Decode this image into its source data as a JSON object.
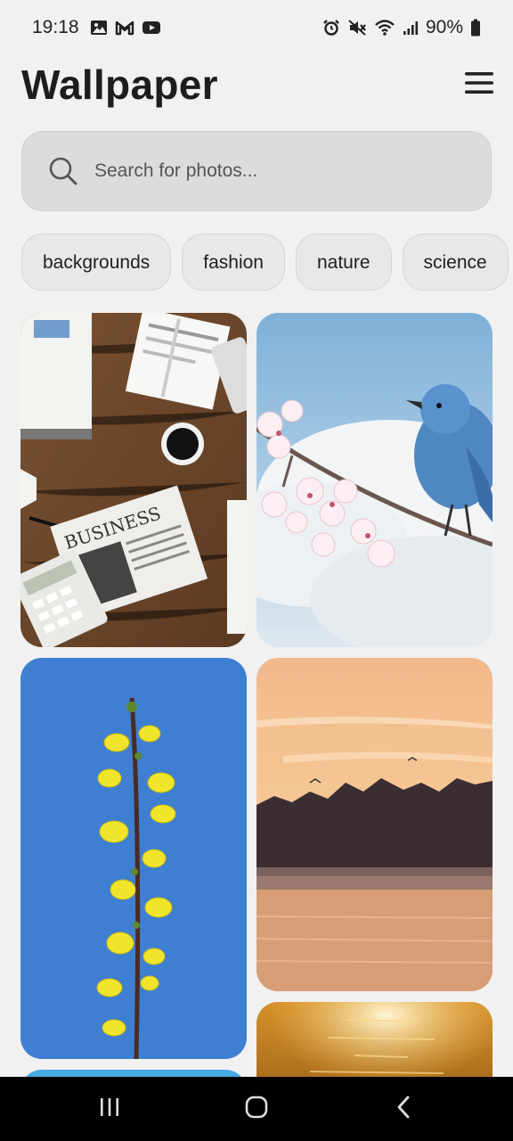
{
  "status_bar": {
    "time": "19:18",
    "battery": "90%",
    "left_icons": [
      "gallery-icon",
      "gmail-icon",
      "youtube-icon"
    ],
    "right_icons": [
      "alarm-icon",
      "mute-icon",
      "wifi-icon",
      "signal-icon",
      "battery-icon"
    ]
  },
  "header": {
    "title": "Wallpaper",
    "menu_icon": "hamburger-menu-icon"
  },
  "search": {
    "placeholder": "Search for photos...",
    "value": "",
    "icon": "search-icon"
  },
  "categories": [
    {
      "label": "backgrounds"
    },
    {
      "label": "fashion"
    },
    {
      "label": "nature"
    },
    {
      "label": "science"
    }
  ],
  "photos": [
    {
      "subject": "business-desk-photo"
    },
    {
      "subject": "blue-bird-blossom-photo"
    },
    {
      "subject": "yellow-flower-branch-photo"
    },
    {
      "subject": "sunset-lake-photo"
    },
    {
      "subject": "blue-sky-photo"
    },
    {
      "subject": "golden-water-photo"
    }
  ],
  "nav_bar": {
    "recent_icon": "recent-apps-icon",
    "home_icon": "home-icon",
    "back_icon": "back-icon"
  },
  "colors": {
    "background": "#f1f1f1",
    "search_bg": "#dcdcdc",
    "chip_bg": "#e8e8e8",
    "title": "#1d1d1d"
  }
}
